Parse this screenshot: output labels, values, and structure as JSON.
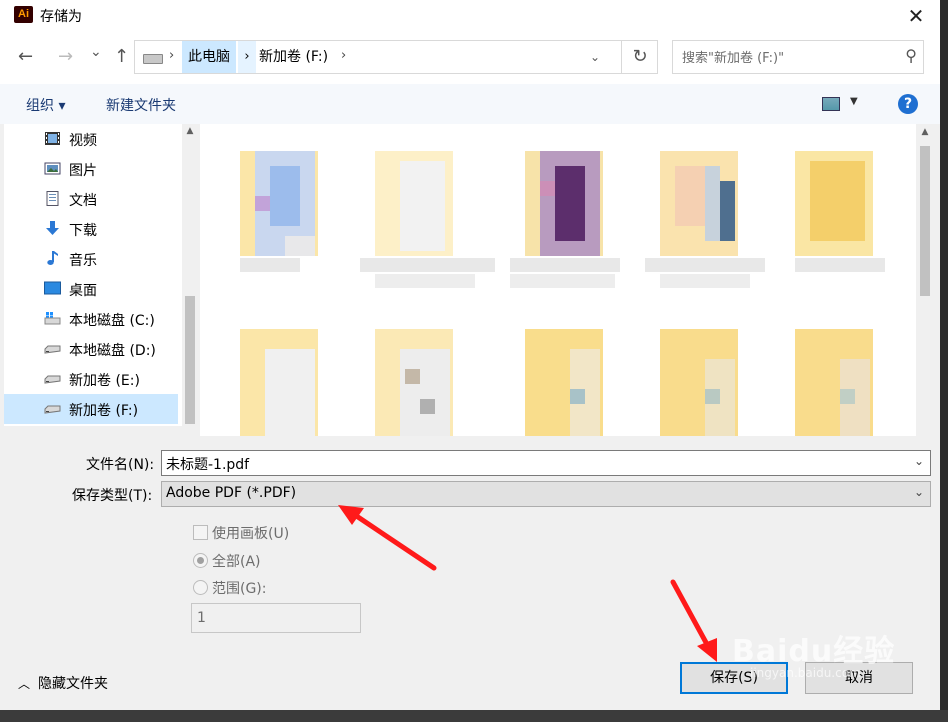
{
  "window": {
    "app_icon_text": "Ai",
    "title": "存储为",
    "close_glyph": "✕"
  },
  "nav": {
    "back": "←",
    "forward": "→",
    "recent": "⌄",
    "up": "↑"
  },
  "address": {
    "crumbs": [
      "此电脑",
      "新加卷 (F:)"
    ],
    "separator": "›",
    "dropdown": "⌄",
    "refresh": "↻"
  },
  "search": {
    "placeholder": "搜索\"新加卷 (F:)\"",
    "icon": "⚲"
  },
  "toolbar": {
    "organize": "组织 ▾",
    "new_folder": "新建文件夹",
    "view_dropdown": "▼",
    "help": "?"
  },
  "sidebar": {
    "items": [
      {
        "label": "视频",
        "icon": "video-icon"
      },
      {
        "label": "图片",
        "icon": "pictures-icon"
      },
      {
        "label": "文档",
        "icon": "documents-icon"
      },
      {
        "label": "下载",
        "icon": "download-icon"
      },
      {
        "label": "音乐",
        "icon": "music-icon"
      },
      {
        "label": "桌面",
        "icon": "desktop-icon"
      },
      {
        "label": "本地磁盘 (C:)",
        "icon": "windows-drive-icon"
      },
      {
        "label": "本地磁盘 (D:)",
        "icon": "drive-icon"
      },
      {
        "label": "新加卷 (E:)",
        "icon": "drive-icon"
      },
      {
        "label": "新加卷 (F:)",
        "icon": "drive-icon",
        "selected": true
      }
    ],
    "scroll_up": "▲"
  },
  "files": {
    "scroll_up": "▲"
  },
  "form": {
    "filename_label": "文件名(N):",
    "filename_value": "未标题-1.pdf",
    "type_label": "保存类型(T):",
    "type_value": "Adobe PDF (*.PDF)",
    "dropdown": "⌄"
  },
  "options": {
    "use_artboards": "使用画板(U)",
    "all": "全部(A)",
    "range": "范围(G):",
    "range_value": "1"
  },
  "footer": {
    "hide_folders": "隐藏文件夹",
    "hide_chev": "︿",
    "save": "保存(S)",
    "cancel": "取消"
  },
  "watermark": {
    "text": "Baidu经验",
    "sub": "jingyan.baidu.com"
  },
  "colors": {
    "accent": "#0078d7",
    "selection": "#cce8ff",
    "annotation": "#ff1a1a"
  }
}
